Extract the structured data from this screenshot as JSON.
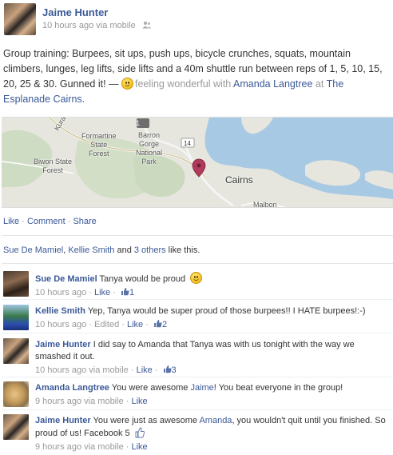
{
  "post": {
    "author": "Jaime Hunter",
    "time": "10 hours ago",
    "via": "via mobile",
    "text_main": "Group training: Burpees, sit ups, push ups, bicycle crunches, squats, mountain climbers, lunges, leg lifts, side lifts and a 40m shuttle run between reps of 1, 5, 10, 15, 20, 25 & 30. Gunned it! —",
    "feeling": "feeling wonderful with",
    "tagged": "Amanda Langtree",
    "at": "at",
    "place": "The Esplanade Cairns."
  },
  "map": {
    "labels": {
      "kuranda": "Kura",
      "formartine": "Formartine\nState\nForest",
      "barron": "Barron\nGorge\nNational\nPark",
      "biwon": "Biwon State\nForest",
      "cairns": "Cairns",
      "malbon": "Malbon",
      "route1": "1",
      "route14": "14"
    }
  },
  "actions": {
    "like": "Like",
    "comment": "Comment",
    "share": "Share",
    "sep": " · "
  },
  "likes": {
    "name1": "Sue De Mamiel",
    "comma": ", ",
    "name2": "Kellie Smith",
    "and": " and ",
    "others": "3 others",
    "suffix": " like this."
  },
  "comments": [
    {
      "author": "Sue De Mamiel",
      "text": " Tanya would be proud",
      "time": "10 hours ago",
      "meta_mid": "",
      "like": "Like",
      "likes": "1"
    },
    {
      "author": "Kellie Smith",
      "text": " Yep, Tanya would be super proud of those burpees!! I HATE burpees!:-)",
      "time": "10 hours ago",
      "meta_mid": " · Edited",
      "like": "Like",
      "likes": "2"
    },
    {
      "author": "Jaime Hunter",
      "text": " I did say to Amanda that Tanya was with us tonight with the way we smashed it out.",
      "time": "10 hours ago",
      "meta_mid": " via mobile",
      "like": "Like",
      "likes": "3"
    },
    {
      "author": "Amanda Langtree",
      "text_pre": " You were awesome ",
      "text_link": "Jaime",
      "text_post": "! You beat everyone in the group!",
      "time": "9 hours ago",
      "meta_mid": " via mobile",
      "like": "Like"
    },
    {
      "author": "Jaime Hunter",
      "text_pre": " You were just as awesome ",
      "text_link": "Amanda",
      "text_post": ", you wouldn't quit until you finished. So proud of us! Facebook 5",
      "time": "9 hours ago",
      "meta_mid": " via mobile",
      "like": "Like"
    }
  ],
  "colors": {
    "link": "#3b5998",
    "meta": "#999999",
    "water": "#a8c9e4",
    "land": "#e8e8e0"
  }
}
